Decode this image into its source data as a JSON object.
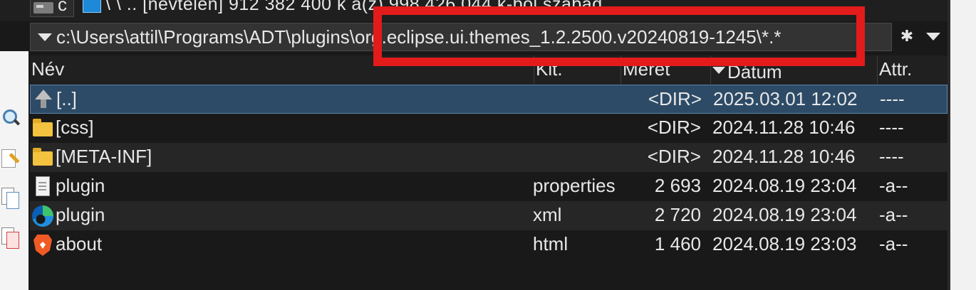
{
  "top": {
    "drive_letter": "c",
    "free_space_text": "\\  \\  ..  [névtelen]  912 382 400 k a(z) 998 426 044 k-ból szabad"
  },
  "path": {
    "prefix": "c:\\Users\\attil\\Programs\\ADT\\plugins",
    "highlighted": "\\org.eclipse.ui.themes_1.2.2500.v20240819-1245\\*.*",
    "filter_icon": "asterisk-icon"
  },
  "columns": {
    "name": "Név",
    "ext": "Kit.",
    "size": "Méret",
    "date": "Dátum",
    "attr": "Attr."
  },
  "files": [
    {
      "icon": "parent-dir-icon",
      "name": "[..]",
      "ext": "",
      "size": "<DIR>",
      "date": "2025.03.01 12:02",
      "attr": "----"
    },
    {
      "icon": "folder-icon",
      "name": "[css]",
      "ext": "",
      "size": "<DIR>",
      "date": "2024.11.28 10:46",
      "attr": "----"
    },
    {
      "icon": "folder-icon",
      "name": "[META-INF]",
      "ext": "",
      "size": "<DIR>",
      "date": "2024.11.28 10:46",
      "attr": "----"
    },
    {
      "icon": "document-icon",
      "name": "plugin",
      "ext": "properties",
      "size": "2 693",
      "date": "2024.08.19 23:04",
      "attr": "-a--"
    },
    {
      "icon": "edge-browser-icon",
      "name": "plugin",
      "ext": "xml",
      "size": "2 720",
      "date": "2024.08.19 23:04",
      "attr": "-a--"
    },
    {
      "icon": "brave-browser-icon",
      "name": "about",
      "ext": "html",
      "size": "1 460",
      "date": "2024.08.19 23:03",
      "attr": "-a--"
    }
  ],
  "colors": {
    "highlight": "#e31b1b",
    "selection": "#2d4b66"
  }
}
